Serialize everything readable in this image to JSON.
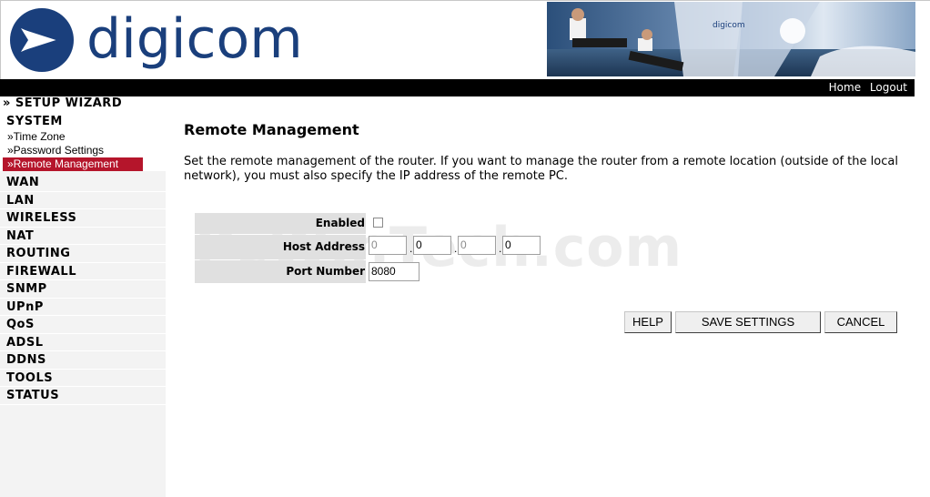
{
  "brand": {
    "name": "digicom"
  },
  "topbar": {
    "home": "Home",
    "logout": "Logout"
  },
  "sidebar": {
    "wizard": "» SETUP WIZARD",
    "system": "SYSTEM",
    "system_items": [
      "»Time Zone",
      "»Password Settings",
      "»Remote Management"
    ],
    "items": [
      "WAN",
      "LAN",
      "WIRELESS",
      "NAT",
      "ROUTING",
      "FIREWALL",
      "SNMP",
      "UPnP",
      "QoS",
      "ADSL",
      "DDNS",
      "TOOLS",
      "STATUS"
    ]
  },
  "main": {
    "title": "Remote Management",
    "description": "Set the remote management of the router. If you want to manage the router from a remote location (outside of the local network), you must also specify the IP address of the remote PC.",
    "watermark": "PcWinTech.com",
    "form": {
      "enabled_label": "Enabled",
      "enabled_checked": false,
      "host_label": "Host Address",
      "host_octets": [
        "0",
        "0",
        "0",
        "0"
      ],
      "port_label": "Port Number",
      "port_value": "8080"
    },
    "buttons": {
      "help": "HELP",
      "save": "SAVE SETTINGS",
      "cancel": "CANCEL"
    }
  },
  "colors": {
    "brand_blue": "#1a3f7c",
    "active_nav": "#b5152b"
  }
}
